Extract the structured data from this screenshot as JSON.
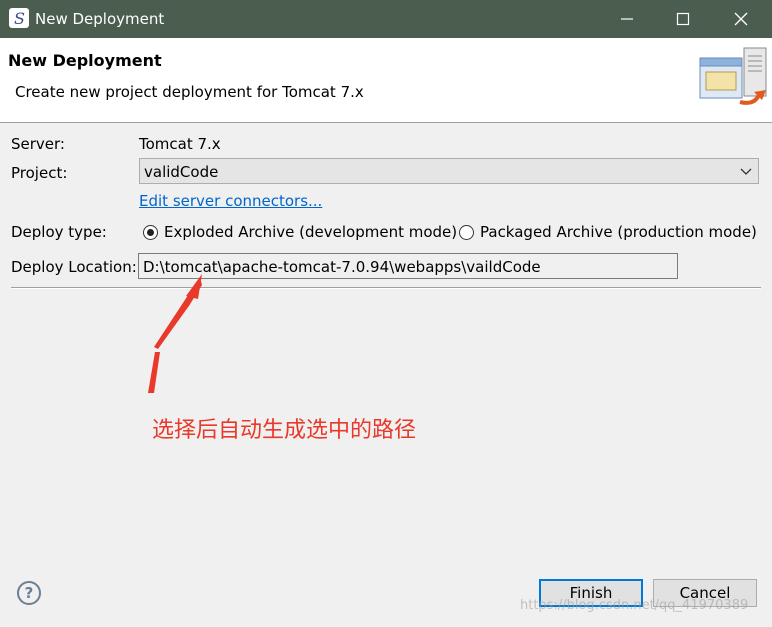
{
  "window": {
    "title": "New Deployment"
  },
  "header": {
    "title": "New Deployment",
    "description": "Create new project deployment for Tomcat  7.x"
  },
  "form": {
    "server_label": "Server:",
    "server_value": "Tomcat  7.x",
    "project_label": "Project:",
    "project_value": "validCode",
    "edit_connectors_link": "Edit server connectors...",
    "deploy_type_label": "Deploy type:",
    "deploy_options": [
      {
        "label": "Exploded Archive (development mode)",
        "selected": true
      },
      {
        "label": "Packaged Archive (production mode)",
        "selected": false
      }
    ],
    "deploy_location_label": "Deploy Location:",
    "deploy_location_value": "D:\\tomcat\\apache-tomcat-7.0.94\\webapps\\vaildCode"
  },
  "annotation": {
    "text": "选择后自动生成选中的路径",
    "color": "#e8392a"
  },
  "footer": {
    "finish_label": "Finish",
    "cancel_label": "Cancel",
    "help_icon": "?"
  },
  "watermark": "https://blog.csdn.net/qq_41970389",
  "colors": {
    "titlebar": "#4a5d4f",
    "link": "#0066cc",
    "default_button_border": "#0078d7"
  },
  "icons": {
    "app": "eclipse-logo-icon",
    "wizard": "server-deploy-icon"
  }
}
